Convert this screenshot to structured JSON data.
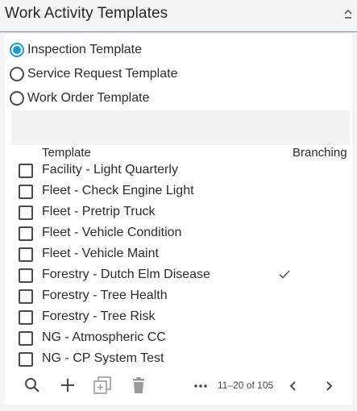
{
  "header": {
    "title": "Work Activity Templates",
    "collapse_icon": "chevron-up-icon"
  },
  "template_types": [
    {
      "label": "Inspection Template",
      "selected": true
    },
    {
      "label": "Service Request Template",
      "selected": false
    },
    {
      "label": "Work Order Template",
      "selected": false
    }
  ],
  "table": {
    "columns": [
      "Template",
      "Branching"
    ],
    "rows": [
      {
        "name": "Facility - Light Quarterly",
        "checked": false,
        "branching": false
      },
      {
        "name": "Fleet - Check Engine Light",
        "checked": false,
        "branching": false
      },
      {
        "name": "Fleet - Pretrip Truck",
        "checked": false,
        "branching": false
      },
      {
        "name": "Fleet - Vehicle Condition",
        "checked": false,
        "branching": false
      },
      {
        "name": "Fleet - Vehicle Maint",
        "checked": false,
        "branching": false
      },
      {
        "name": "Forestry - Dutch Elm Disease",
        "checked": false,
        "branching": true
      },
      {
        "name": "Forestry - Tree Health",
        "checked": false,
        "branching": false
      },
      {
        "name": "Forestry - Tree Risk",
        "checked": false,
        "branching": false
      },
      {
        "name": "NG - Atmospheric CC",
        "checked": false,
        "branching": false
      },
      {
        "name": "NG - CP System Test",
        "checked": false,
        "branching": false
      }
    ]
  },
  "toolbar": {
    "icons": [
      "search-icon",
      "add-icon",
      "copy-icon",
      "delete-icon",
      "more-icon",
      "previous-page-icon",
      "next-page-icon"
    ],
    "pager_text": "11–20 of 105"
  },
  "colors": {
    "accent": "#1a9bd6",
    "header_rule": "#2aa3b0",
    "disabled_icon": "#9a9a9a"
  }
}
